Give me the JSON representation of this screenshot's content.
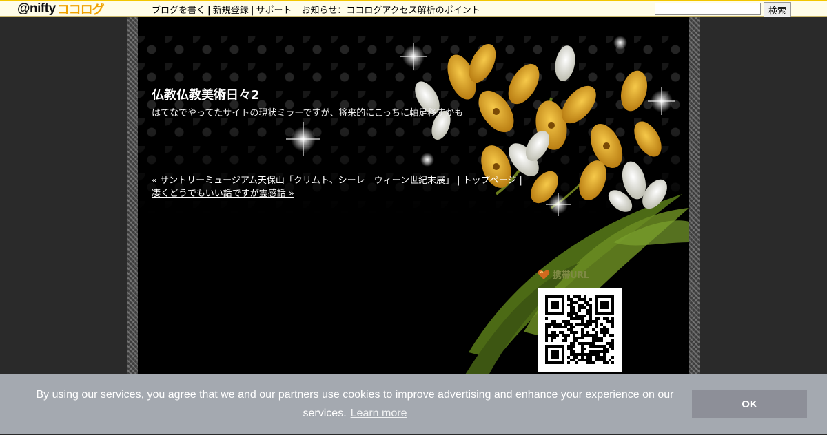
{
  "topbar": {
    "logo_at_nifty": "@nifty",
    "logo_cocolog": "ココログ",
    "nav": [
      "ブログを書く",
      "新規登録",
      "サポート"
    ],
    "notice_label": "お知らせ",
    "notice_colon": "：",
    "notice_link": "ココログアクセス解析のポイント",
    "search_value": "",
    "search_button": "検索"
  },
  "blog": {
    "title": "仏教仏教美術日々2",
    "description": "はてなでやってたサイトの現状ミラーですが、将来的にこっちに軸足移すかも"
  },
  "entry_nav": {
    "prev": "« サントリーミュージアム天保山「クリムト、シーレ　ウィーン世紀末展」",
    "separator": " | ",
    "top": "トップページ",
    "separator2": " | ",
    "next": "凄くどうでもいい話ですが霊感話 »"
  },
  "sidebar": {
    "mobile_heading": "携帯URL"
  },
  "cookie": {
    "message_before": "By using our services, you agree that we and our ",
    "partners": "partners",
    "message_after": " use cookies to improve advertising and enhance your experience on our services.",
    "learn_more": "Learn more",
    "ok": "OK"
  },
  "colors": {
    "topbar_bg": "#fffde8",
    "topbar_accent": "#f3c600",
    "page_bg": "#2a2a2a",
    "content_bg": "#000000",
    "sidebar_heading": "#7f8a45",
    "cookie_bg": "#a4a9b0",
    "cookie_button": "#8d8f98"
  },
  "icons": {
    "mobile_heading": "heart-badge-icon"
  }
}
